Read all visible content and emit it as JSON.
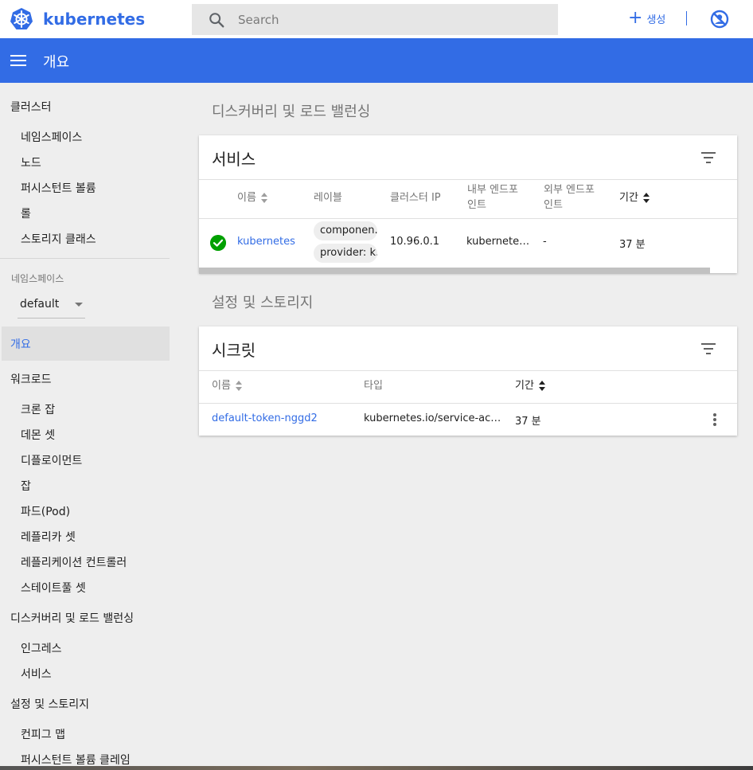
{
  "header": {
    "brand": "kubernetes",
    "search_placeholder": "Search",
    "create_label": "생성"
  },
  "titlebar": {
    "title": "개요"
  },
  "sidebar": {
    "cluster": {
      "label": "클러스터",
      "items": [
        "네임스페이스",
        "노드",
        "퍼시스턴트 볼륨",
        "롤",
        "스토리지 클래스"
      ]
    },
    "namespace_caption": "네임스페이스",
    "namespace_value": "default",
    "overview": "개요",
    "workloads": {
      "label": "워크로드",
      "items": [
        "크론 잡",
        "데몬 셋",
        "디플로이먼트",
        "잡",
        "파드(Pod)",
        "레플리카 셋",
        "레플리케이션 컨트롤러",
        "스테이트풀 셋"
      ]
    },
    "discovery": {
      "label": "디스커버리 및 로드 밸런싱",
      "items": [
        "인그레스",
        "서비스"
      ]
    },
    "config": {
      "label": "설정 및 스토리지",
      "items": [
        "컨피그 맵",
        "퍼시스턴트 볼륨 클레임"
      ]
    }
  },
  "main": {
    "discovery_section": "디스커버리 및 로드 밸런싱",
    "services": {
      "title": "서비스",
      "headers": {
        "name": "이름",
        "labels": "레이블",
        "cluster_ip": "클러스터 IP",
        "internal_endpoints_1": "내부 엔드포",
        "internal_endpoints_2": "인트",
        "external_endpoints_1": "외부 엔드포",
        "external_endpoints_2": "인트",
        "age": "기간"
      },
      "rows": [
        {
          "name": "kubernetes",
          "label_1": "componen...",
          "label_2": "provider: k...",
          "cluster_ip": "10.96.0.1",
          "internal_endpoints": "kubernetes...",
          "external_endpoints": "-",
          "age": "37 분"
        }
      ]
    },
    "config_section": "설정 및 스토리지",
    "secrets": {
      "title": "시크릿",
      "headers": {
        "name": "이름",
        "type": "타입",
        "age": "기간"
      },
      "rows": [
        {
          "name": "default-token-nggd2",
          "type": "kubernetes.io/service-acc...",
          "age": "37 분"
        }
      ]
    }
  },
  "colors": {
    "accent": "#326ce5",
    "status_ok": "#00a000"
  }
}
